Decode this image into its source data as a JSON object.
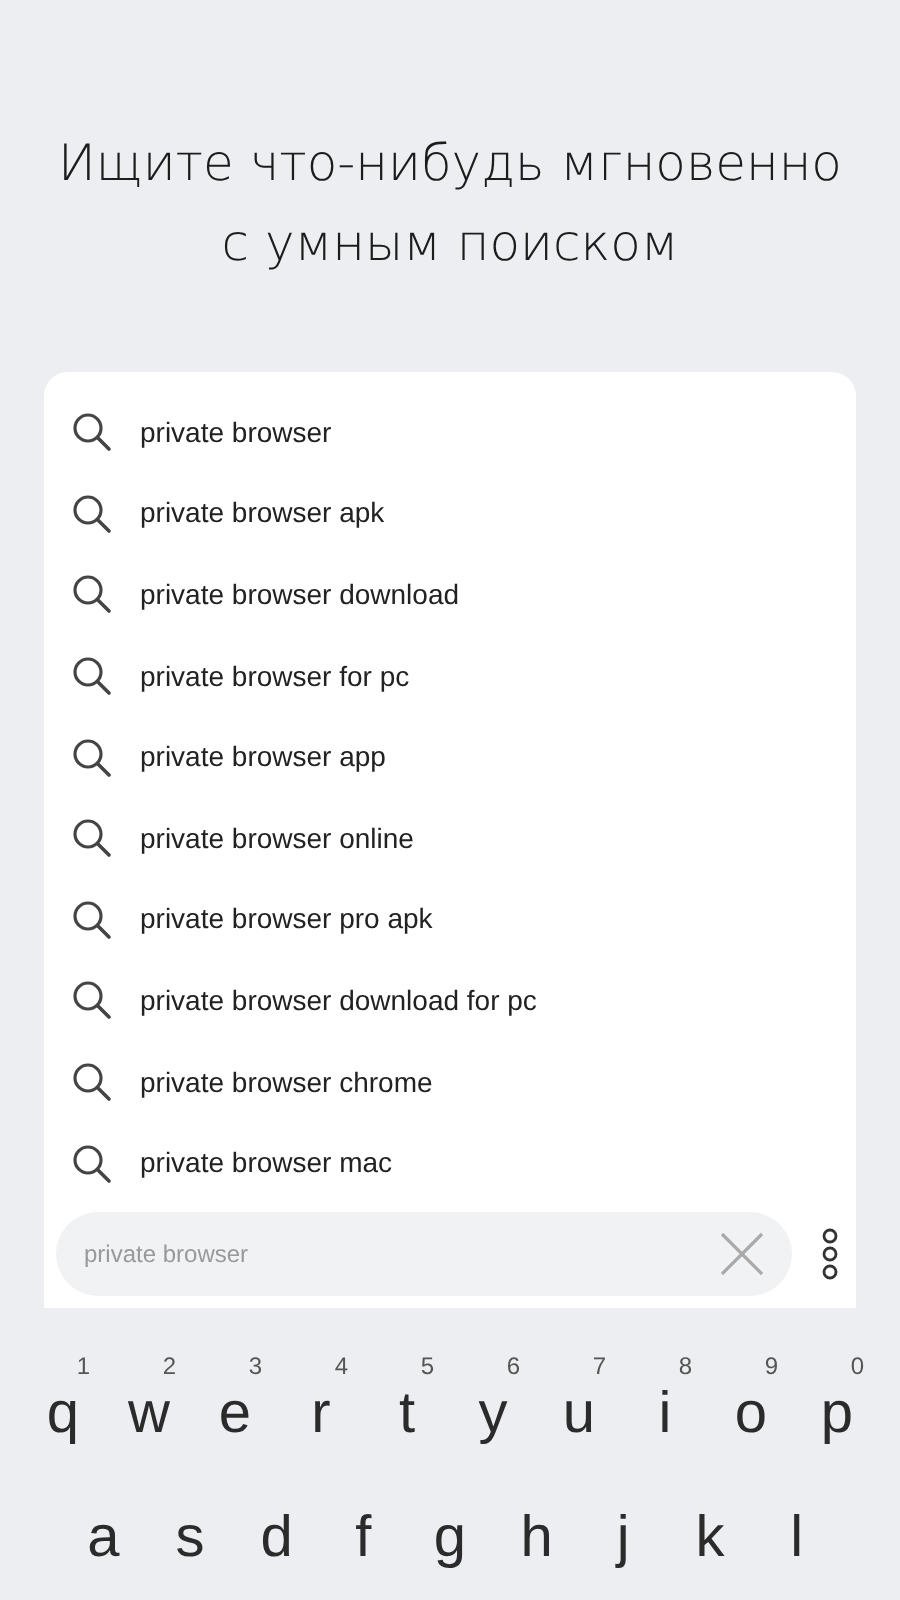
{
  "headline": "Ищите что-нибудь мгновенно с умным поиском",
  "suggestions": [
    {
      "text": "private browser"
    },
    {
      "text": "private browser apk"
    },
    {
      "text": "private browser download"
    },
    {
      "text": "private browser for pc"
    },
    {
      "text": "private browser app"
    },
    {
      "text": "private browser online"
    },
    {
      "text": "private browser pro apk"
    },
    {
      "text": "private browser download for pc"
    },
    {
      "text": "private browser chrome"
    },
    {
      "text": "private browser mac"
    }
  ],
  "search_bar": {
    "value": "private browser"
  },
  "keyboard": {
    "rows": [
      [
        {
          "letter": "q",
          "hint": "1"
        },
        {
          "letter": "w",
          "hint": "2"
        },
        {
          "letter": "e",
          "hint": "3"
        },
        {
          "letter": "r",
          "hint": "4"
        },
        {
          "letter": "t",
          "hint": "5"
        },
        {
          "letter": "y",
          "hint": "6"
        },
        {
          "letter": "u",
          "hint": "7"
        },
        {
          "letter": "i",
          "hint": "8"
        },
        {
          "letter": "o",
          "hint": "9"
        },
        {
          "letter": "p",
          "hint": "0"
        }
      ],
      [
        {
          "letter": "a"
        },
        {
          "letter": "s"
        },
        {
          "letter": "d"
        },
        {
          "letter": "f"
        },
        {
          "letter": "g"
        },
        {
          "letter": "h"
        },
        {
          "letter": "j"
        },
        {
          "letter": "k"
        },
        {
          "letter": "l"
        }
      ]
    ]
  }
}
